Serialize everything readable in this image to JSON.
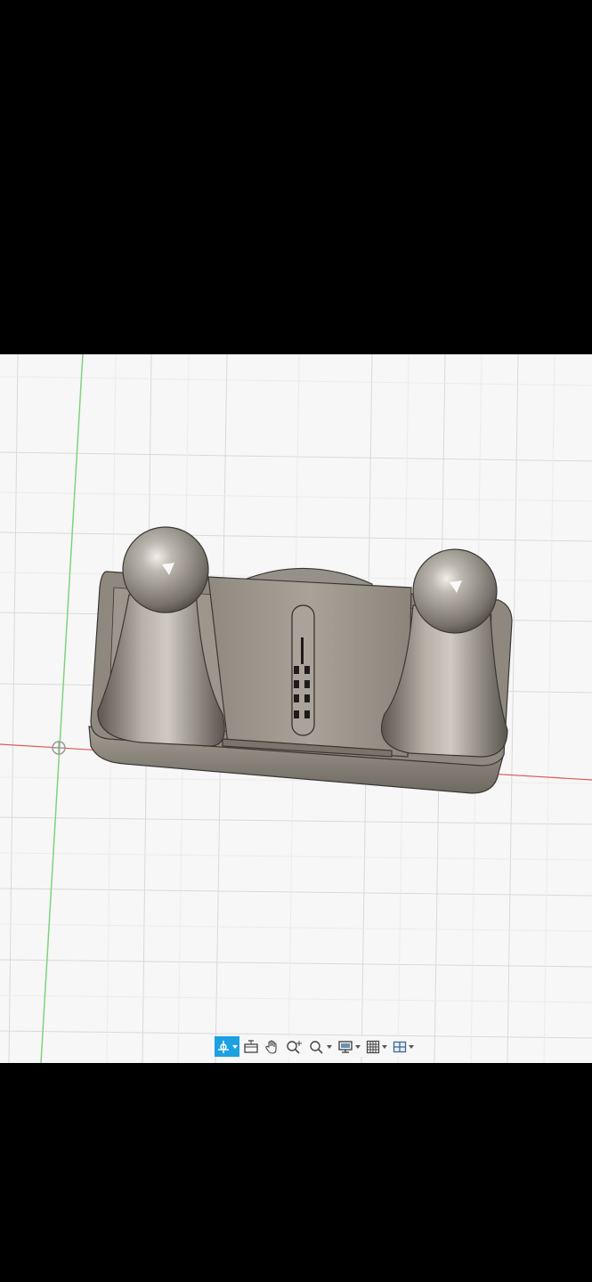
{
  "viewport": {
    "background": "#f7f7f7",
    "grid_color": "#d9d9d9",
    "x_axis_color": "#e05a5a",
    "y_axis_color": "#7ed37e"
  },
  "model": {
    "body_color": "#8c867c",
    "highlight_color": "#cfcac2",
    "shadow_color": "#4e4a44"
  },
  "toolbar": {
    "accent": "#1ba1e2",
    "items": [
      {
        "icon": "orbit-icon",
        "has_menu": true,
        "active": true
      },
      {
        "icon": "look-at-icon",
        "has_menu": false,
        "active": false
      },
      {
        "icon": "pan-hand-icon",
        "has_menu": false,
        "active": false
      },
      {
        "icon": "zoom-icon",
        "has_menu": false,
        "active": false
      },
      {
        "icon": "fit-zoom-icon",
        "has_menu": true,
        "active": false
      },
      {
        "icon": "display-settings-icon",
        "has_menu": true,
        "active": false
      },
      {
        "icon": "grid-snap-icon",
        "has_menu": true,
        "active": false
      },
      {
        "icon": "viewports-icon",
        "has_menu": true,
        "active": false
      }
    ]
  }
}
